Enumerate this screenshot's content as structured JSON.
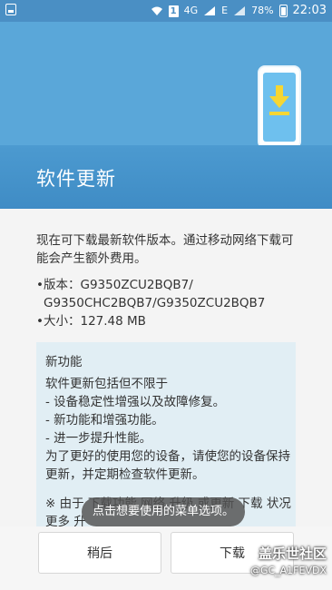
{
  "status_bar": {
    "network_type": "4G",
    "network_indicator": "E",
    "sim_label": "1",
    "battery": "78%",
    "time": "22:03",
    "icons": [
      "notification-icon",
      "wifi-icon",
      "sim-icon",
      "signal-icon",
      "battery-icon"
    ]
  },
  "header": {
    "title": "软件更新",
    "illustration": "phone-download-icon",
    "accent_color": "#3f8cc5",
    "banner_color": "#5aa7d9"
  },
  "content": {
    "intro": "现在可下载最新软件版本。通过移动网络下载可能会产生额外费用。",
    "version_label": "版本：",
    "version_line1": "G9350ZCU2BQB7/",
    "version_line2": "G9350CHC2BQB7/G9350ZCU2BQB7",
    "size_label": "大小：",
    "size_value": "127.48 MB",
    "new_features": {
      "title": "新功能",
      "body": [
        "软件更新包括但不限于",
        "- 设备稳定性增强以及故障修复。",
        "- 新功能和增强功能。",
        "- 进一步提升性能。",
        "为了更好的使用您的设备，请使您的设备保持更新，并定期检查软件更新。"
      ],
      "note_partial": "※ 由于 下载功能 网络 升级 或更新 下载 状况 更多 升"
    }
  },
  "buttons": {
    "later": "稍后",
    "download": "下载"
  },
  "toast": "点击想要使用的菜单选项。",
  "watermark": {
    "line1": "盖乐世社区",
    "line2": "@GC_A1FEVDX"
  }
}
